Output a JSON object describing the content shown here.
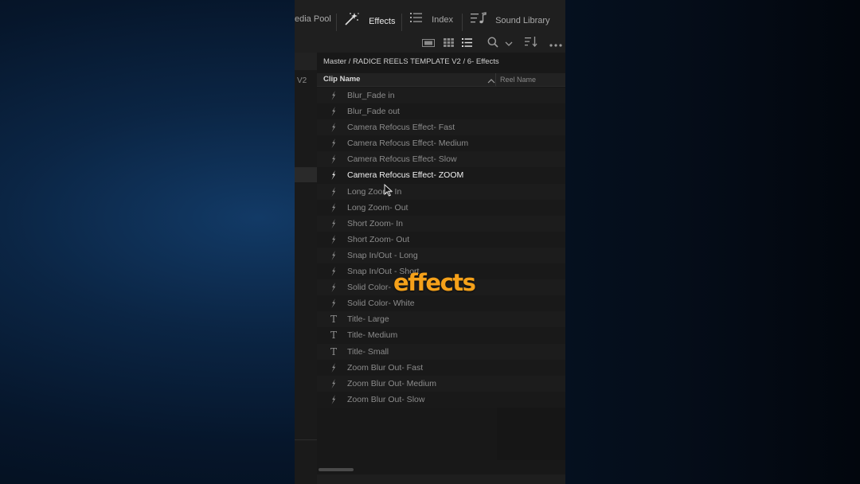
{
  "tabs": [
    {
      "label": "edia Pool",
      "icon": "media-pool-icon"
    },
    {
      "label": "Effects",
      "icon": "magic-wand-icon",
      "active": true
    },
    {
      "label": "Index",
      "icon": "list-index-icon"
    },
    {
      "label": "Sound Library",
      "icon": "music-list-icon"
    }
  ],
  "left_strip": {
    "track_label": "V2"
  },
  "breadcrumb": "Master / RADICE REELS TEMPLATE V2 / 6- Effects",
  "columns": {
    "clip_name": "Clip Name",
    "reel_name": "Reel Name"
  },
  "clips": [
    {
      "name": "Blur_Fade in",
      "icon": "effect-icon"
    },
    {
      "name": "Blur_Fade out",
      "icon": "effect-icon"
    },
    {
      "name": "Camera Refocus Effect- Fast",
      "icon": "effect-icon"
    },
    {
      "name": "Camera Refocus Effect- Medium",
      "icon": "effect-icon"
    },
    {
      "name": "Camera Refocus Effect- Slow",
      "icon": "effect-icon"
    },
    {
      "name": "Camera Refocus Effect- ZOOM",
      "icon": "effect-icon",
      "highlighted": true
    },
    {
      "name": "Long Zoom- In",
      "icon": "effect-icon"
    },
    {
      "name": "Long Zoom- Out",
      "icon": "effect-icon"
    },
    {
      "name": "Short Zoom- In",
      "icon": "effect-icon"
    },
    {
      "name": "Short Zoom- Out",
      "icon": "effect-icon"
    },
    {
      "name": "Snap In/Out - Long",
      "icon": "effect-icon"
    },
    {
      "name": "Snap In/Out - Short",
      "icon": "effect-icon"
    },
    {
      "name": "Solid Color-",
      "icon": "effect-icon"
    },
    {
      "name": "Solid Color- White",
      "icon": "effect-icon"
    },
    {
      "name": "Title- Large",
      "icon": "title-icon"
    },
    {
      "name": "Title- Medium",
      "icon": "title-icon"
    },
    {
      "name": "Title- Small",
      "icon": "title-icon"
    },
    {
      "name": "Zoom Blur Out- Fast",
      "icon": "effect-icon"
    },
    {
      "name": "Zoom Blur Out- Medium",
      "icon": "effect-icon"
    },
    {
      "name": "Zoom Blur Out- Slow",
      "icon": "effect-icon"
    }
  ],
  "caption": "effects",
  "colors": {
    "caption": "#f5a11a",
    "highlight_text": "#f2f2f2",
    "row_text": "#8c8c8c"
  }
}
